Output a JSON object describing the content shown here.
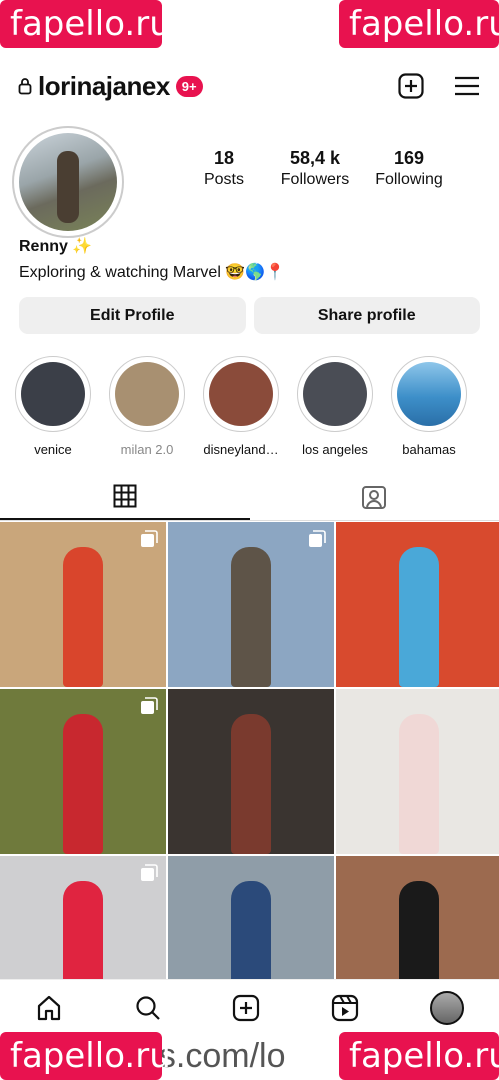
{
  "watermark": "fapello.ru",
  "bottom_url_partial": "ns.com/lo",
  "profile": {
    "username": "lorinajanex",
    "notif_badge": "9+",
    "stats": [
      {
        "num": "18",
        "label": "Posts"
      },
      {
        "num": "58,4 k",
        "label": "Followers"
      },
      {
        "num": "169",
        "label": "Following"
      }
    ],
    "display_name": "Renny ✨",
    "bio": "Exploring & watching Marvel 🤓🌎📍"
  },
  "buttons": {
    "edit": "Edit Profile",
    "share": "Share profile"
  },
  "highlights": [
    {
      "label": "venice",
      "color": "#3b3f48",
      "muted": false
    },
    {
      "label": "milan 2.0",
      "color": "#a89071",
      "muted": true
    },
    {
      "label": "disneyland…",
      "color": "#8a4b3a",
      "muted": false
    },
    {
      "label": "los angeles",
      "color": "#4a4d55",
      "muted": false
    },
    {
      "label": "bahamas",
      "color": "#3d8fc9",
      "muted": false
    }
  ],
  "posts": [
    {
      "bg": "#c9a67b",
      "fig": "#d9452c",
      "multi": true
    },
    {
      "bg": "#8ca6c2",
      "fig": "#5e5448",
      "multi": true
    },
    {
      "bg": "#d84a2e",
      "fig": "#4aa8d8",
      "multi": false
    },
    {
      "bg": "#6f7a3c",
      "fig": "#c8282f",
      "multi": true
    },
    {
      "bg": "#3a3430",
      "fig": "#7a3a2e",
      "multi": false
    },
    {
      "bg": "#e9e7e3",
      "fig": "#f0d8d6",
      "multi": false
    },
    {
      "bg": "#cfcfd1",
      "fig": "#e02440",
      "multi": true
    },
    {
      "bg": "#8f9da8",
      "fig": "#2b4a7a",
      "multi": false
    },
    {
      "bg": "#9c6a4f",
      "fig": "#1a1a1a",
      "multi": false
    }
  ]
}
